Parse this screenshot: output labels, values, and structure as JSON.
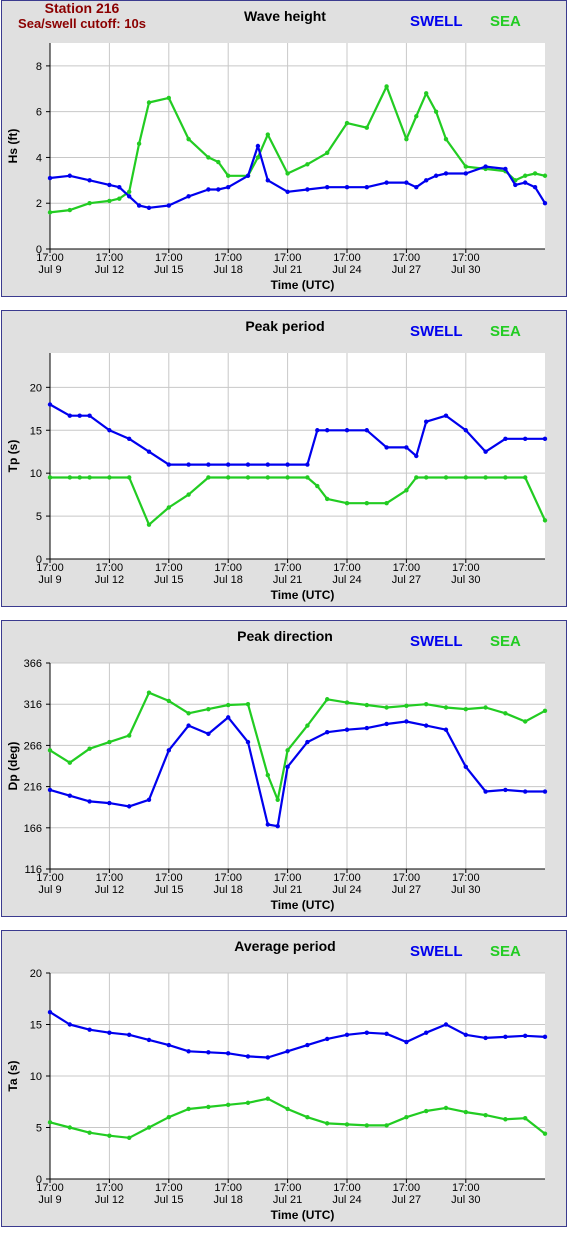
{
  "header": {
    "station": "Station 216",
    "cutoff": "Sea/swell cutoff: 10s"
  },
  "legend": {
    "swell": "SWELL",
    "sea": "SEA"
  },
  "colors": {
    "swell": "#0000ee",
    "sea": "#22cc22",
    "plot_bg": "#ffffff",
    "outer_bg": "#e0e0e0",
    "grid": "#c8c8c8",
    "header": "#8b0000"
  },
  "x_axis": {
    "label": "Time (UTC)",
    "ticks": [
      {
        "time": "17:00",
        "date": "Jul 9"
      },
      {
        "time": "17:00",
        "date": "Jul 12"
      },
      {
        "time": "17:00",
        "date": "Jul 15"
      },
      {
        "time": "17:00",
        "date": "Jul 18"
      },
      {
        "time": "17:00",
        "date": "Jul 21"
      },
      {
        "time": "17:00",
        "date": "Jul 24"
      },
      {
        "time": "17:00",
        "date": "Jul 27"
      },
      {
        "time": "17:00",
        "date": "Jul 30"
      }
    ]
  },
  "chart_data": [
    {
      "type": "line",
      "title": "Wave height",
      "ylabel": "Hs (ft)",
      "xlabel": "Time (UTC)",
      "ylim": [
        0,
        9
      ],
      "yticks": [
        "0",
        "2",
        "4",
        "6",
        "8"
      ],
      "ytick_values": [
        0,
        2,
        4,
        6,
        8
      ],
      "x": [
        0,
        1,
        2,
        3,
        3.5,
        4,
        4.5,
        5,
        6,
        7,
        8,
        8.5,
        9,
        10,
        10.5,
        11,
        12,
        13,
        14,
        15,
        16,
        17,
        18,
        18.5,
        19,
        19.5,
        20,
        21,
        22,
        23,
        23.5,
        24,
        24.5,
        25
      ],
      "series": [
        {
          "name": "SWELL",
          "values": [
            3.1,
            3.2,
            3.0,
            2.8,
            2.7,
            2.3,
            1.9,
            1.8,
            1.9,
            2.3,
            2.6,
            2.6,
            2.7,
            3.2,
            4.5,
            3.0,
            2.5,
            2.6,
            2.7,
            2.7,
            2.7,
            2.9,
            2.9,
            2.7,
            3.0,
            3.2,
            3.3,
            3.3,
            3.6,
            3.5,
            2.8,
            2.9,
            2.7,
            2.0
          ]
        },
        {
          "name": "SEA",
          "values": [
            1.6,
            1.7,
            2.0,
            2.1,
            2.2,
            2.5,
            4.6,
            6.4,
            6.6,
            4.8,
            4.0,
            3.8,
            3.2,
            3.2,
            4.0,
            5.0,
            3.3,
            3.7,
            4.2,
            5.5,
            5.3,
            7.1,
            4.8,
            5.8,
            6.8,
            6.0,
            4.8,
            3.6,
            3.5,
            3.4,
            3.0,
            3.2,
            3.3,
            3.2
          ]
        }
      ]
    },
    {
      "type": "line",
      "title": "Peak period",
      "ylabel": "Tp (s)",
      "xlabel": "Time (UTC)",
      "ylim": [
        0,
        24
      ],
      "yticks": [
        "0",
        "5",
        "10",
        "15",
        "20"
      ],
      "ytick_values": [
        0,
        5,
        10,
        15,
        20
      ],
      "x": [
        0,
        1,
        1.5,
        2,
        3,
        4,
        5,
        6,
        7,
        8,
        9,
        10,
        11,
        12,
        13,
        13.5,
        14,
        15,
        16,
        17,
        18,
        18.5,
        19,
        20,
        21,
        22,
        23,
        24,
        25
      ],
      "series": [
        {
          "name": "SWELL",
          "values": [
            18,
            16.7,
            16.7,
            16.7,
            15,
            14,
            12.5,
            11,
            11,
            11,
            11,
            11,
            11,
            11,
            11,
            15,
            15,
            15,
            15,
            13,
            13,
            12,
            16,
            16.7,
            15,
            12.5,
            14,
            14,
            14
          ]
        },
        {
          "name": "SEA",
          "values": [
            9.5,
            9.5,
            9.5,
            9.5,
            9.5,
            9.5,
            4.0,
            6.0,
            7.5,
            9.5,
            9.5,
            9.5,
            9.5,
            9.5,
            9.5,
            8.5,
            7.0,
            6.5,
            6.5,
            6.5,
            8.0,
            9.5,
            9.5,
            9.5,
            9.5,
            9.5,
            9.5,
            9.5,
            4.5
          ]
        }
      ]
    },
    {
      "type": "line",
      "title": "Peak direction",
      "ylabel": "Dp (deg)",
      "xlabel": "Time (UTC)",
      "ylim": [
        116,
        366
      ],
      "yticks": [
        "116",
        "166",
        "216",
        "266",
        "316",
        "366"
      ],
      "ytick_values": [
        116,
        166,
        216,
        266,
        316,
        366
      ],
      "x": [
        0,
        1,
        2,
        3,
        4,
        5,
        6,
        7,
        8,
        9,
        10,
        11,
        11.5,
        12,
        13,
        14,
        15,
        16,
        17,
        18,
        19,
        20,
        21,
        22,
        23,
        24,
        25
      ],
      "series": [
        {
          "name": "SWELL",
          "values": [
            212,
            205,
            198,
            196,
            192,
            200,
            260,
            290,
            280,
            300,
            270,
            170,
            168,
            240,
            270,
            282,
            285,
            287,
            292,
            295,
            290,
            285,
            240,
            210,
            212,
            210,
            210
          ]
        },
        {
          "name": "SEA",
          "values": [
            260,
            245,
            262,
            270,
            278,
            330,
            320,
            305,
            310,
            315,
            316,
            230,
            200,
            260,
            290,
            322,
            318,
            315,
            312,
            314,
            316,
            312,
            310,
            312,
            305,
            295,
            308
          ]
        }
      ]
    },
    {
      "type": "line",
      "title": "Average period",
      "ylabel": "Ta (s)",
      "xlabel": "Time (UTC)",
      "ylim": [
        0,
        20
      ],
      "yticks": [
        "0",
        "5",
        "10",
        "15",
        "20"
      ],
      "ytick_values": [
        0,
        5,
        10,
        15,
        20
      ],
      "x": [
        0,
        1,
        2,
        3,
        4,
        5,
        6,
        7,
        8,
        9,
        10,
        11,
        12,
        13,
        14,
        15,
        16,
        17,
        18,
        19,
        20,
        21,
        22,
        23,
        24,
        25
      ],
      "series": [
        {
          "name": "SWELL",
          "values": [
            16.2,
            15.0,
            14.5,
            14.2,
            14.0,
            13.5,
            13.0,
            12.4,
            12.3,
            12.2,
            11.9,
            11.8,
            12.4,
            13.0,
            13.6,
            14.0,
            14.2,
            14.1,
            13.3,
            14.2,
            15.0,
            14.0,
            13.7,
            13.8,
            13.9,
            13.8
          ]
        },
        {
          "name": "SEA",
          "values": [
            5.5,
            5.0,
            4.5,
            4.2,
            4.0,
            5.0,
            6.0,
            6.8,
            7.0,
            7.2,
            7.4,
            7.8,
            6.8,
            6.0,
            5.4,
            5.3,
            5.2,
            5.2,
            6.0,
            6.6,
            6.9,
            6.5,
            6.2,
            5.8,
            5.9,
            4.4
          ]
        }
      ]
    }
  ]
}
